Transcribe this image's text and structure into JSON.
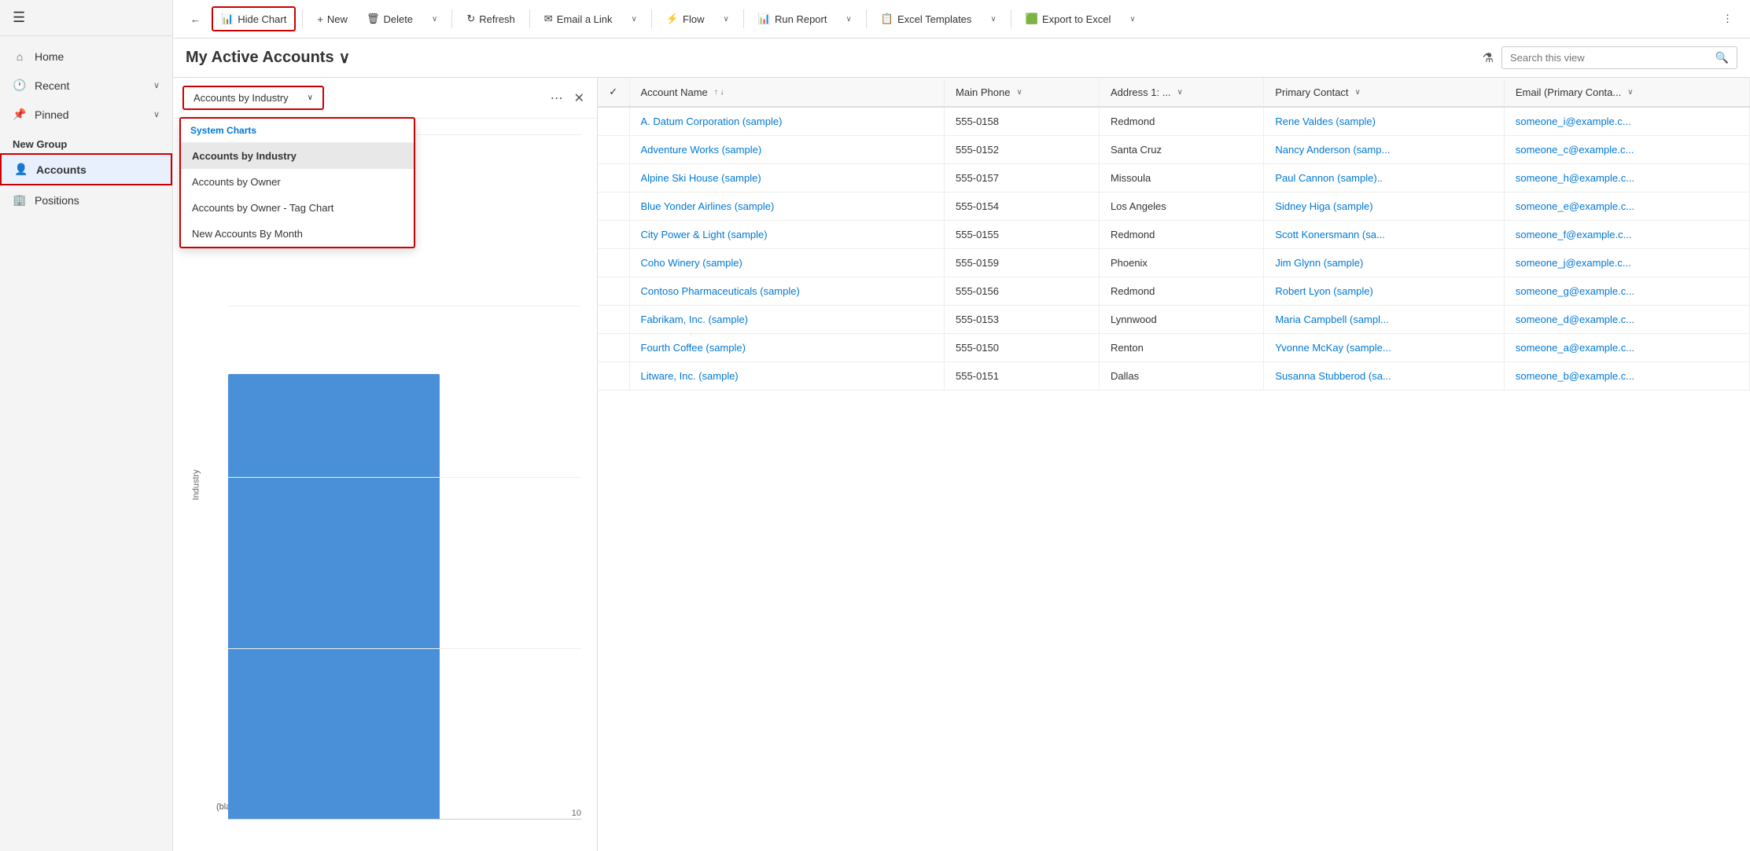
{
  "sidebar": {
    "hamburger": "☰",
    "nav_items": [
      {
        "id": "home",
        "label": "Home",
        "icon": "⌂",
        "has_arrow": false
      },
      {
        "id": "recent",
        "label": "Recent",
        "icon": "🕐",
        "has_arrow": true
      },
      {
        "id": "pinned",
        "label": "Pinned",
        "icon": "📌",
        "has_arrow": true
      }
    ],
    "group_label": "New Group",
    "group_items": [
      {
        "id": "accounts",
        "label": "Accounts",
        "icon": "👤",
        "active": true
      },
      {
        "id": "positions",
        "label": "Positions",
        "icon": "🏢",
        "active": false
      }
    ]
  },
  "toolbar": {
    "hide_chart": "Hide Chart",
    "new": "New",
    "delete": "Delete",
    "refresh": "Refresh",
    "email_link": "Email a Link",
    "flow": "Flow",
    "run_report": "Run Report",
    "excel_templates": "Excel Templates",
    "export_to_excel": "Export to Excel"
  },
  "page": {
    "title": "My Active Accounts",
    "search_placeholder": "Search this view"
  },
  "chart": {
    "selected_chart": "Accounts by Industry",
    "section_label": "System Charts",
    "items": [
      {
        "id": "by_industry",
        "label": "Accounts by Industry",
        "selected": true
      },
      {
        "id": "by_owner",
        "label": "Accounts by Owner",
        "selected": false
      },
      {
        "id": "by_owner_tag",
        "label": "Accounts by Owner - Tag Chart",
        "selected": false
      },
      {
        "id": "new_by_month",
        "label": "New Accounts By Month",
        "selected": false
      }
    ],
    "y_axis_label": "Industry",
    "x_axis_value": "10",
    "blank_label": "(blank)",
    "bar_height_pct": 70
  },
  "table": {
    "columns": [
      {
        "id": "check",
        "label": "✓",
        "sortable": false
      },
      {
        "id": "account_name",
        "label": "Account Name",
        "sortable": true,
        "sort_dir": "asc"
      },
      {
        "id": "main_phone",
        "label": "Main Phone",
        "sortable": true
      },
      {
        "id": "address1",
        "label": "Address 1: ...",
        "sortable": true
      },
      {
        "id": "primary_contact",
        "label": "Primary Contact",
        "sortable": true
      },
      {
        "id": "email",
        "label": "Email (Primary Conta...",
        "sortable": true
      }
    ],
    "rows": [
      {
        "account_name": "A. Datum Corporation (sample)",
        "main_phone": "555-0158",
        "address1": "Redmond",
        "primary_contact": "Rene Valdes (sample)",
        "email": "someone_i@example.c..."
      },
      {
        "account_name": "Adventure Works (sample)",
        "main_phone": "555-0152",
        "address1": "Santa Cruz",
        "primary_contact": "Nancy Anderson (samp...",
        "email": "someone_c@example.c..."
      },
      {
        "account_name": "Alpine Ski House (sample)",
        "main_phone": "555-0157",
        "address1": "Missoula",
        "primary_contact": "Paul Cannon (sample)..",
        "email": "someone_h@example.c..."
      },
      {
        "account_name": "Blue Yonder Airlines (sample)",
        "main_phone": "555-0154",
        "address1": "Los Angeles",
        "primary_contact": "Sidney Higa (sample)",
        "email": "someone_e@example.c..."
      },
      {
        "account_name": "City Power & Light (sample)",
        "main_phone": "555-0155",
        "address1": "Redmond",
        "primary_contact": "Scott Konersmann (sa...",
        "email": "someone_f@example.c..."
      },
      {
        "account_name": "Coho Winery (sample)",
        "main_phone": "555-0159",
        "address1": "Phoenix",
        "primary_contact": "Jim Glynn (sample)",
        "email": "someone_j@example.c..."
      },
      {
        "account_name": "Contoso Pharmaceuticals (sample)",
        "main_phone": "555-0156",
        "address1": "Redmond",
        "primary_contact": "Robert Lyon (sample)",
        "email": "someone_g@example.c..."
      },
      {
        "account_name": "Fabrikam, Inc. (sample)",
        "main_phone": "555-0153",
        "address1": "Lynnwood",
        "primary_contact": "Maria Campbell (sampl...",
        "email": "someone_d@example.c..."
      },
      {
        "account_name": "Fourth Coffee (sample)",
        "main_phone": "555-0150",
        "address1": "Renton",
        "primary_contact": "Yvonne McKay (sample...",
        "email": "someone_a@example.c..."
      },
      {
        "account_name": "Litware, Inc. (sample)",
        "main_phone": "555-0151",
        "address1": "Dallas",
        "primary_contact": "Susanna Stubberod (sa...",
        "email": "someone_b@example.c..."
      }
    ]
  }
}
